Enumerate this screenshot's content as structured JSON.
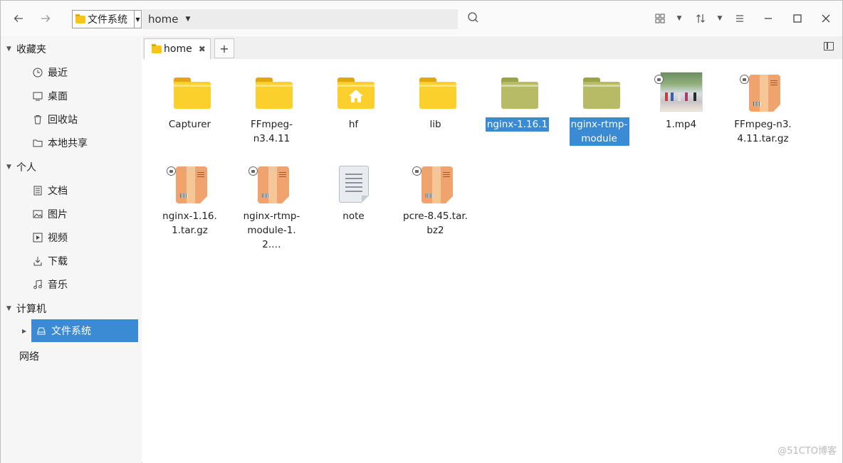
{
  "toolbar": {
    "location_label": "文件系统",
    "breadcrumb": "home",
    "icons": [
      "back-icon",
      "forward-icon",
      "search-icon",
      "grid-view-icon",
      "sort-icon",
      "menu-icon",
      "minimize-icon",
      "maximize-icon",
      "close-icon"
    ]
  },
  "sidebar": {
    "favorites": {
      "title": "收藏夹",
      "items": [
        {
          "label": "最近",
          "icon": "clock-icon"
        },
        {
          "label": "桌面",
          "icon": "desktop-icon"
        },
        {
          "label": "回收站",
          "icon": "trash-icon"
        },
        {
          "label": "本地共享",
          "icon": "folder-share-icon"
        }
      ]
    },
    "personal": {
      "title": "个人",
      "items": [
        {
          "label": "文档",
          "icon": "document-icon"
        },
        {
          "label": "图片",
          "icon": "picture-icon"
        },
        {
          "label": "视频",
          "icon": "video-icon"
        },
        {
          "label": "下载",
          "icon": "download-icon"
        },
        {
          "label": "音乐",
          "icon": "music-icon"
        }
      ]
    },
    "computer": {
      "title": "计算机",
      "items": [
        {
          "label": "文件系统",
          "icon": "drive-icon",
          "active": true
        }
      ]
    },
    "network": {
      "title": "网络"
    }
  },
  "tabs": [
    {
      "label": "home"
    }
  ],
  "files": [
    {
      "name": "Capturer",
      "type": "folder"
    },
    {
      "name": "FFmpeg-n3.4.11",
      "type": "folder"
    },
    {
      "name": "hf",
      "type": "home-folder"
    },
    {
      "name": "lib",
      "type": "folder"
    },
    {
      "name": "nginx-1.16.1",
      "type": "folder",
      "selected": true
    },
    {
      "name": "nginx-rtmp-module",
      "type": "folder",
      "selected": true
    },
    {
      "name": "1.mp4",
      "type": "video",
      "locked": true
    },
    {
      "name": "FFmpeg-n3.4.11.tar.gz",
      "type": "archive",
      "locked": true
    },
    {
      "name": "nginx-1.16.1.tar.gz",
      "type": "archive",
      "locked": true
    },
    {
      "name": "nginx-rtmp-module-1.2.…",
      "type": "archive",
      "locked": true
    },
    {
      "name": "note",
      "type": "text"
    },
    {
      "name": "pcre-8.45.tar.bz2",
      "type": "archive",
      "locked": true
    }
  ],
  "colors": {
    "accent": "#3a8ad4",
    "folder": "#fbd02c",
    "folder_selected": "#b7bb66",
    "archive": "#f0a36c"
  },
  "watermark": "@51CTO博客"
}
